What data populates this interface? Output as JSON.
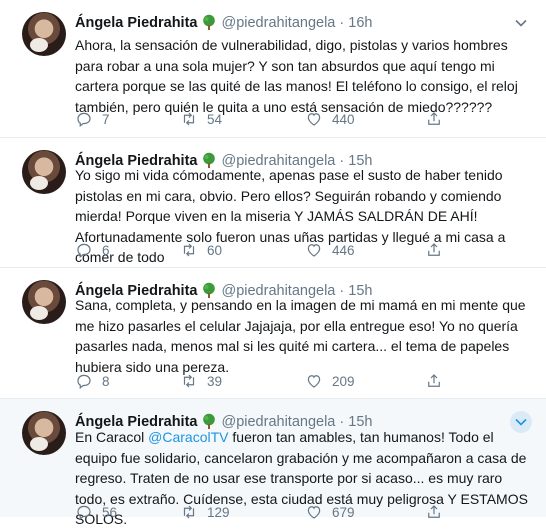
{
  "colors": {
    "handle": "#657786",
    "link": "#1b95e0",
    "text": "#14171a",
    "highlight_bg": "#f5f8fa"
  },
  "tweets": [
    {
      "name": "Ángela Piedrahita",
      "handle": "@piedrahitangela",
      "separator": "·",
      "time": "16h",
      "text_parts": [
        "Ahora,  la sensación de vulnerabilidad, digo, pistolas y varios hombres para robar a una sola mujer? Y son tan absurdos que aquí tengo mi cartera porque se las quité de las manos! El teléfono lo consigo, el reloj también, pero quién le quita a uno está sensación de miedo??????"
      ],
      "replies": "7",
      "retweets": "54",
      "likes": "440"
    },
    {
      "name": "Ángela Piedrahita",
      "handle": "@piedrahitangela",
      "separator": "·",
      "time": "15h",
      "text_parts": [
        "Yo sigo mi vida cómodamente, apenas pase el susto de haber tenido pistolas en mi cara, obvio. Pero ellos? Seguirán robando y comiendo mierda! Porque viven en la miseria Y JAMÁS SALDRÁN DE AHÍ! Afortunadamente solo fueron unas uñas partidas y llegué a mi casa a comer de todo"
      ],
      "replies": "6",
      "retweets": "60",
      "likes": "446"
    },
    {
      "name": "Ángela Piedrahita",
      "handle": "@piedrahitangela",
      "separator": "·",
      "time": "15h",
      "text_parts": [
        "Sana, completa, y pensando en la imagen de mi mamá en mi mente que me hizo pasarles el celular Jajajaja, por ella entregue eso! Yo no quería pasarles nada, menos mal si les quité mi cartera... el tema de papeles hubiera sido una pereza."
      ],
      "replies": "8",
      "retweets": "39",
      "likes": "209"
    },
    {
      "name": "Ángela Piedrahita",
      "handle": "@piedrahitangela",
      "separator": "·",
      "time": "15h",
      "text_before": "En Caracol ",
      "mention": "@CaracolTV",
      "text_after": " fueron tan amables, tan humanos! Todo el equipo fue solidario, cancelaron grabación y me acompañaron a casa de regreso. Traten de no usar ese transporte por si acaso... es muy raro todo, es extraño. Cuídense, esta ciudad está muy peligrosa Y ESTAMOS SOLOS.",
      "replies": "56",
      "retweets": "129",
      "likes": "679"
    }
  ]
}
